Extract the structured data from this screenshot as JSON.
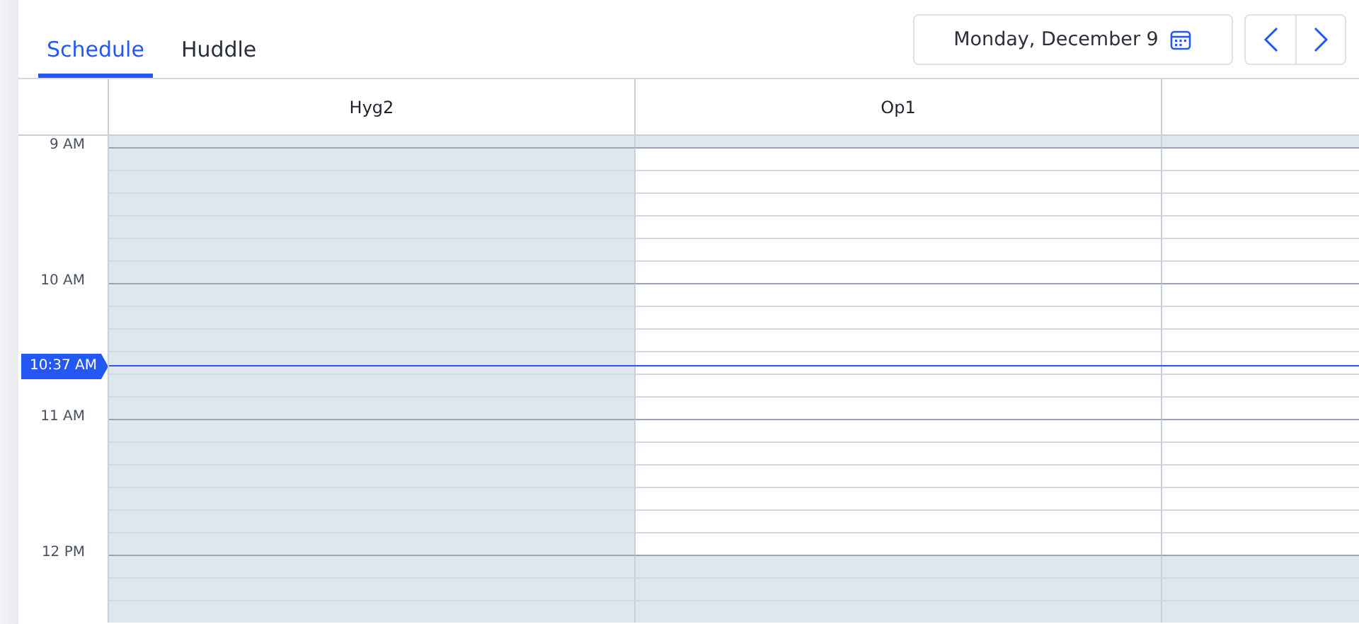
{
  "tabs": [
    {
      "label": "Schedule",
      "selected": true
    },
    {
      "label": "Huddle",
      "selected": false
    }
  ],
  "date_picker": {
    "value": "Monday, December 9"
  },
  "columns": [
    {
      "name": "Hyg2"
    },
    {
      "name": "Op1"
    },
    {}
  ],
  "slots": [
    {
      "open": [
        false,
        false,
        false
      ]
    },
    {
      "time": "9 AM",
      "open": [
        false,
        true,
        true
      ]
    },
    {
      "open": [
        false,
        true,
        true
      ]
    },
    {
      "open": [
        false,
        true,
        true
      ]
    },
    {
      "open": [
        false,
        true,
        true
      ]
    },
    {
      "open": [
        false,
        true,
        true
      ]
    },
    {
      "open": [
        false,
        true,
        true
      ]
    },
    {
      "time": "10 AM",
      "open": [
        false,
        true,
        true
      ]
    },
    {
      "open": [
        false,
        true,
        true
      ]
    },
    {
      "open": [
        false,
        true,
        true
      ]
    },
    {
      "now": "10:37 AM",
      "open": [
        false,
        true,
        true
      ]
    },
    {
      "open": [
        false,
        true,
        true
      ]
    },
    {
      "open": [
        false,
        true,
        true
      ]
    },
    {
      "time": "11 AM",
      "open": [
        false,
        true,
        true
      ]
    },
    {
      "open": [
        false,
        true,
        true
      ]
    },
    {
      "open": [
        false,
        true,
        true
      ]
    },
    {
      "open": [
        false,
        true,
        true
      ]
    },
    {
      "open": [
        false,
        true,
        true
      ]
    },
    {
      "open": [
        false,
        true,
        true
      ]
    },
    {
      "time": "12 PM",
      "open": [
        false,
        false,
        false
      ]
    },
    {
      "open": [
        false,
        false,
        false
      ]
    },
    {
      "open": [
        false,
        false,
        false
      ]
    }
  ]
}
